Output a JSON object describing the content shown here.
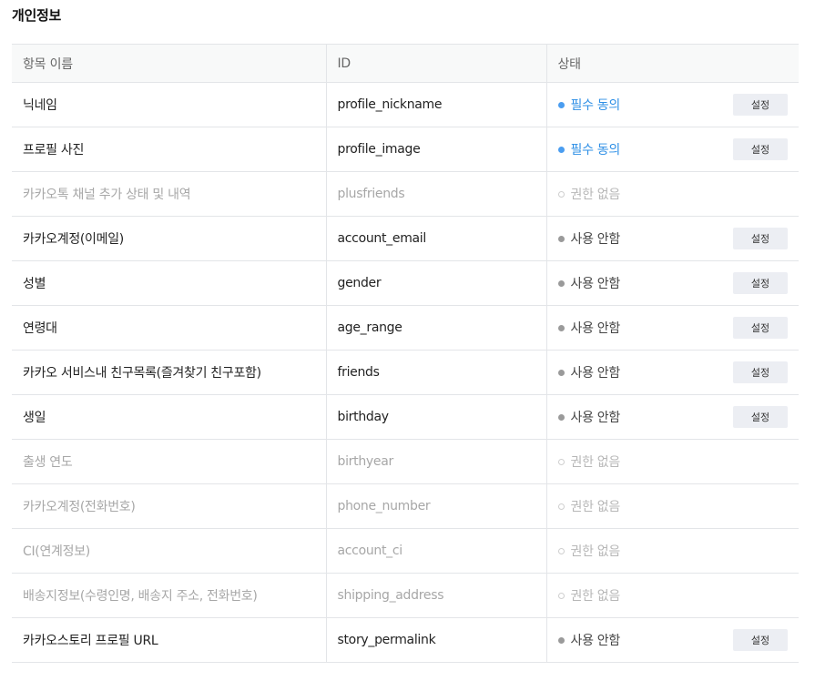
{
  "section_title": "개인정보",
  "columns": {
    "name": "항목 이름",
    "id": "ID",
    "status": "상태"
  },
  "rows": [
    {
      "name": "닉네임",
      "id": "profile_nickname",
      "status": "필수 동의",
      "kind": "required",
      "button": "설정"
    },
    {
      "name": "프로필 사진",
      "id": "profile_image",
      "status": "필수 동의",
      "kind": "required",
      "button": "설정"
    },
    {
      "name": "카카오톡 채널 추가 상태 및 내역",
      "id": "plusfriends",
      "status": "권한 없음",
      "kind": "none",
      "button": ""
    },
    {
      "name": "카카오계정(이메일)",
      "id": "account_email",
      "status": "사용 안함",
      "kind": "unused",
      "button": "설정"
    },
    {
      "name": "성별",
      "id": "gender",
      "status": "사용 안함",
      "kind": "unused",
      "button": "설정"
    },
    {
      "name": "연령대",
      "id": "age_range",
      "status": "사용 안함",
      "kind": "unused",
      "button": "설정"
    },
    {
      "name": "카카오 서비스내 친구목록(즐겨찾기 친구포함)",
      "id": "friends",
      "status": "사용 안함",
      "kind": "unused",
      "button": "설정"
    },
    {
      "name": "생일",
      "id": "birthday",
      "status": "사용 안함",
      "kind": "unused",
      "button": "설정"
    },
    {
      "name": "출생 연도",
      "id": "birthyear",
      "status": "권한 없음",
      "kind": "none",
      "button": ""
    },
    {
      "name": "카카오계정(전화번호)",
      "id": "phone_number",
      "status": "권한 없음",
      "kind": "none",
      "button": ""
    },
    {
      "name": "CI(연계정보)",
      "id": "account_ci",
      "status": "권한 없음",
      "kind": "none",
      "button": ""
    },
    {
      "name": "배송지정보(수령인명, 배송지 주소, 전화번호)",
      "id": "shipping_address",
      "status": "권한 없음",
      "kind": "none",
      "button": ""
    },
    {
      "name": "카카오스토리 프로필 URL",
      "id": "story_permalink",
      "status": "사용 안함",
      "kind": "unused",
      "button": "설정"
    }
  ],
  "colors": {
    "required": "#2e8fe6",
    "unused": "#444444",
    "none": "#b7b7b7",
    "header_bg": "#f8f9f9",
    "button_bg": "#eceef3"
  }
}
